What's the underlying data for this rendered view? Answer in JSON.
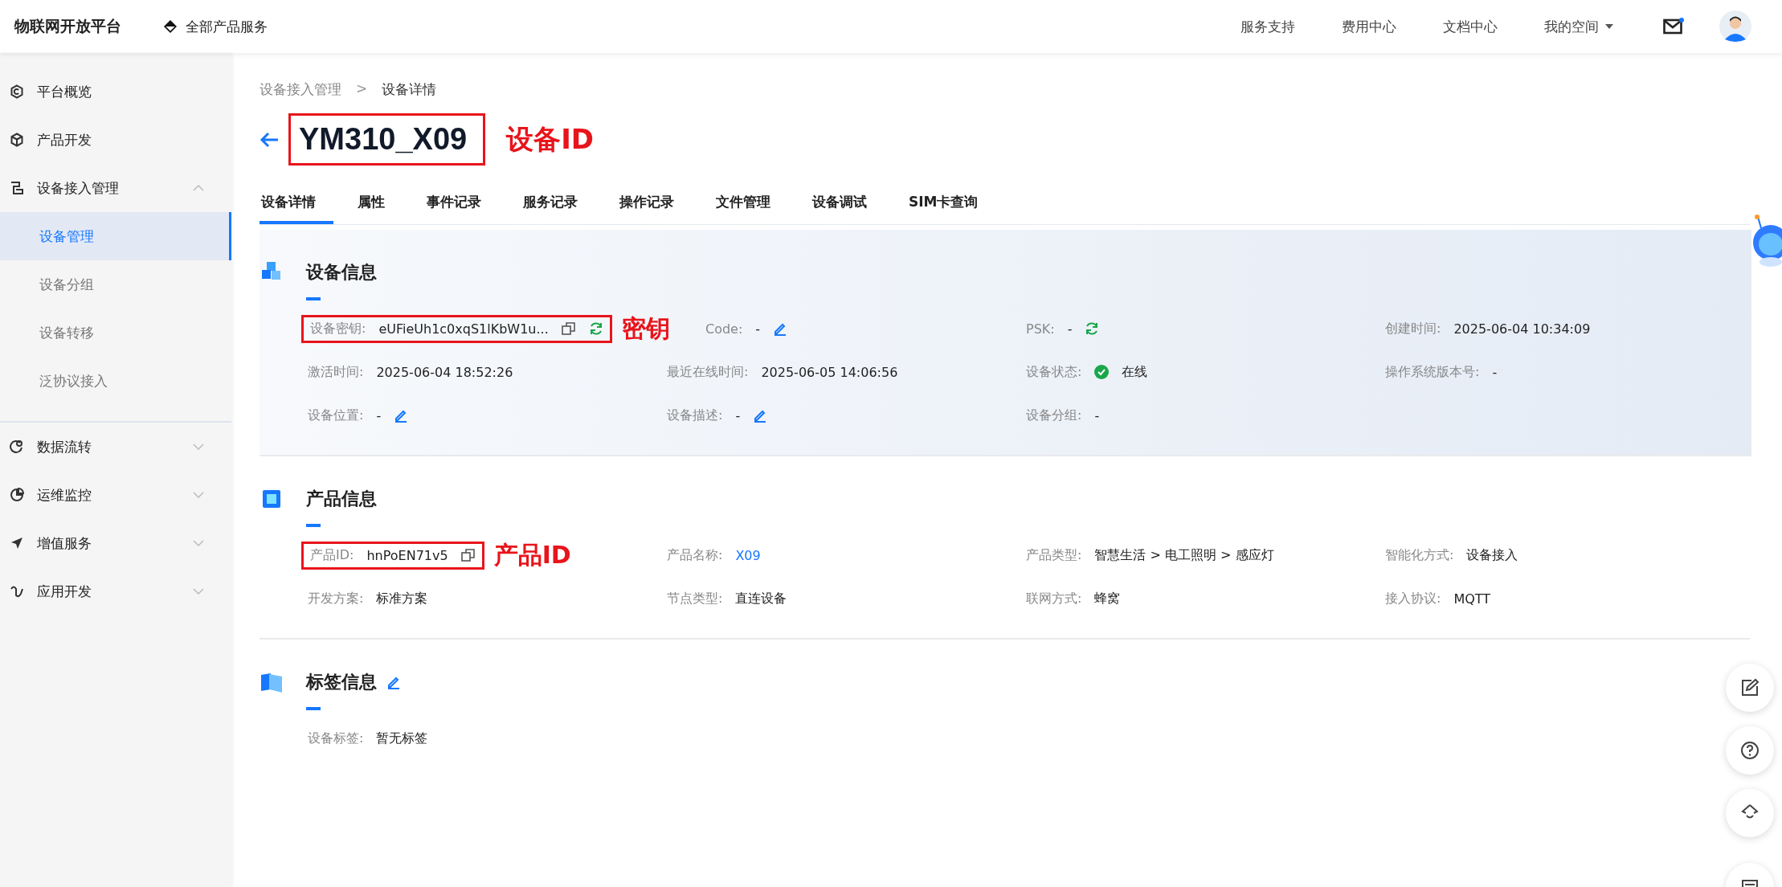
{
  "topbar": {
    "brand": "物联网开放平台",
    "all_products": "全部产品服务",
    "links": [
      "服务支持",
      "费用中心",
      "文档中心"
    ],
    "workspace": "我的空间",
    "mail_unread": true
  },
  "sidebar": {
    "items": [
      {
        "label": "平台概览",
        "kind": "link"
      },
      {
        "label": "产品开发",
        "kind": "link"
      },
      {
        "label": "设备接入管理",
        "kind": "group",
        "expanded": true,
        "children": [
          {
            "label": "设备管理",
            "selected": true
          },
          {
            "label": "设备分组",
            "selected": false
          },
          {
            "label": "设备转移",
            "selected": false
          },
          {
            "label": "泛协议接入",
            "selected": false
          }
        ]
      },
      {
        "label": "数据流转",
        "kind": "group",
        "expanded": false
      },
      {
        "label": "运维监控",
        "kind": "group",
        "expanded": false
      },
      {
        "label": "增值服务",
        "kind": "group",
        "expanded": false
      },
      {
        "label": "应用开发",
        "kind": "group",
        "expanded": false
      }
    ]
  },
  "breadcrumb": {
    "items": [
      "设备接入管理",
      "设备详情"
    ],
    "separator": ">"
  },
  "title": {
    "text": "YM310_X09",
    "annotation": "设备ID"
  },
  "tabs": [
    {
      "label": "设备详情",
      "selected": true
    },
    {
      "label": "属性",
      "selected": false
    },
    {
      "label": "事件记录",
      "selected": false
    },
    {
      "label": "服务记录",
      "selected": false
    },
    {
      "label": "操作记录",
      "selected": false
    },
    {
      "label": "文件管理",
      "selected": false
    },
    {
      "label": "设备调试",
      "selected": false
    },
    {
      "label": "SIM卡查询",
      "selected": false
    }
  ],
  "sections": [
    {
      "title": "设备信息",
      "kind": "device",
      "fields": [
        {
          "label": "设备密钥:",
          "value": "eUFieUh1c0xqS1lKbW1u...",
          "copy": true,
          "refresh": true,
          "annotation": "密钥"
        },
        {
          "label": "Code:",
          "value": "-",
          "edit": true
        },
        {
          "label": "PSK:",
          "value": "-",
          "refresh": true
        },
        {
          "label": "创建时间:",
          "value": "2025-06-04 10:34:09"
        },
        {
          "label": "激活时间:",
          "value": "2025-06-04 18:52:26"
        },
        {
          "label": "最近在线时间:",
          "value": "2025-06-05 14:06:56"
        },
        {
          "label": "设备状态:",
          "value": "在线",
          "online": true
        },
        {
          "label": "操作系统版本号:",
          "value": "-"
        },
        {
          "label": "设备位置:",
          "value": "-",
          "edit": true
        },
        {
          "label": "设备描述:",
          "value": "-",
          "edit": true
        },
        {
          "label": "设备分组:",
          "value": "-"
        }
      ]
    },
    {
      "title": "产品信息",
      "kind": "product",
      "fields": [
        {
          "label": "产品ID:",
          "value": "hnPoEN71v5",
          "copy": true,
          "annotation": "产品ID"
        },
        {
          "label": "产品名称:",
          "value": "X09",
          "link": true
        },
        {
          "label": "产品类型:",
          "value": "智慧生活 > 电工照明 > 感应灯"
        },
        {
          "label": "智能化方式:",
          "value": "设备接入"
        },
        {
          "label": "开发方案:",
          "value": "标准方案"
        },
        {
          "label": "节点类型:",
          "value": "直连设备"
        },
        {
          "label": "联网方式:",
          "value": "蜂窝"
        },
        {
          "label": "接入协议:",
          "value": "MQTT"
        }
      ]
    },
    {
      "title": "标签信息",
      "kind": "tags",
      "title_edit": true,
      "fields": [
        {
          "label": "设备标签:",
          "value": "暂无标签"
        }
      ]
    }
  ]
}
